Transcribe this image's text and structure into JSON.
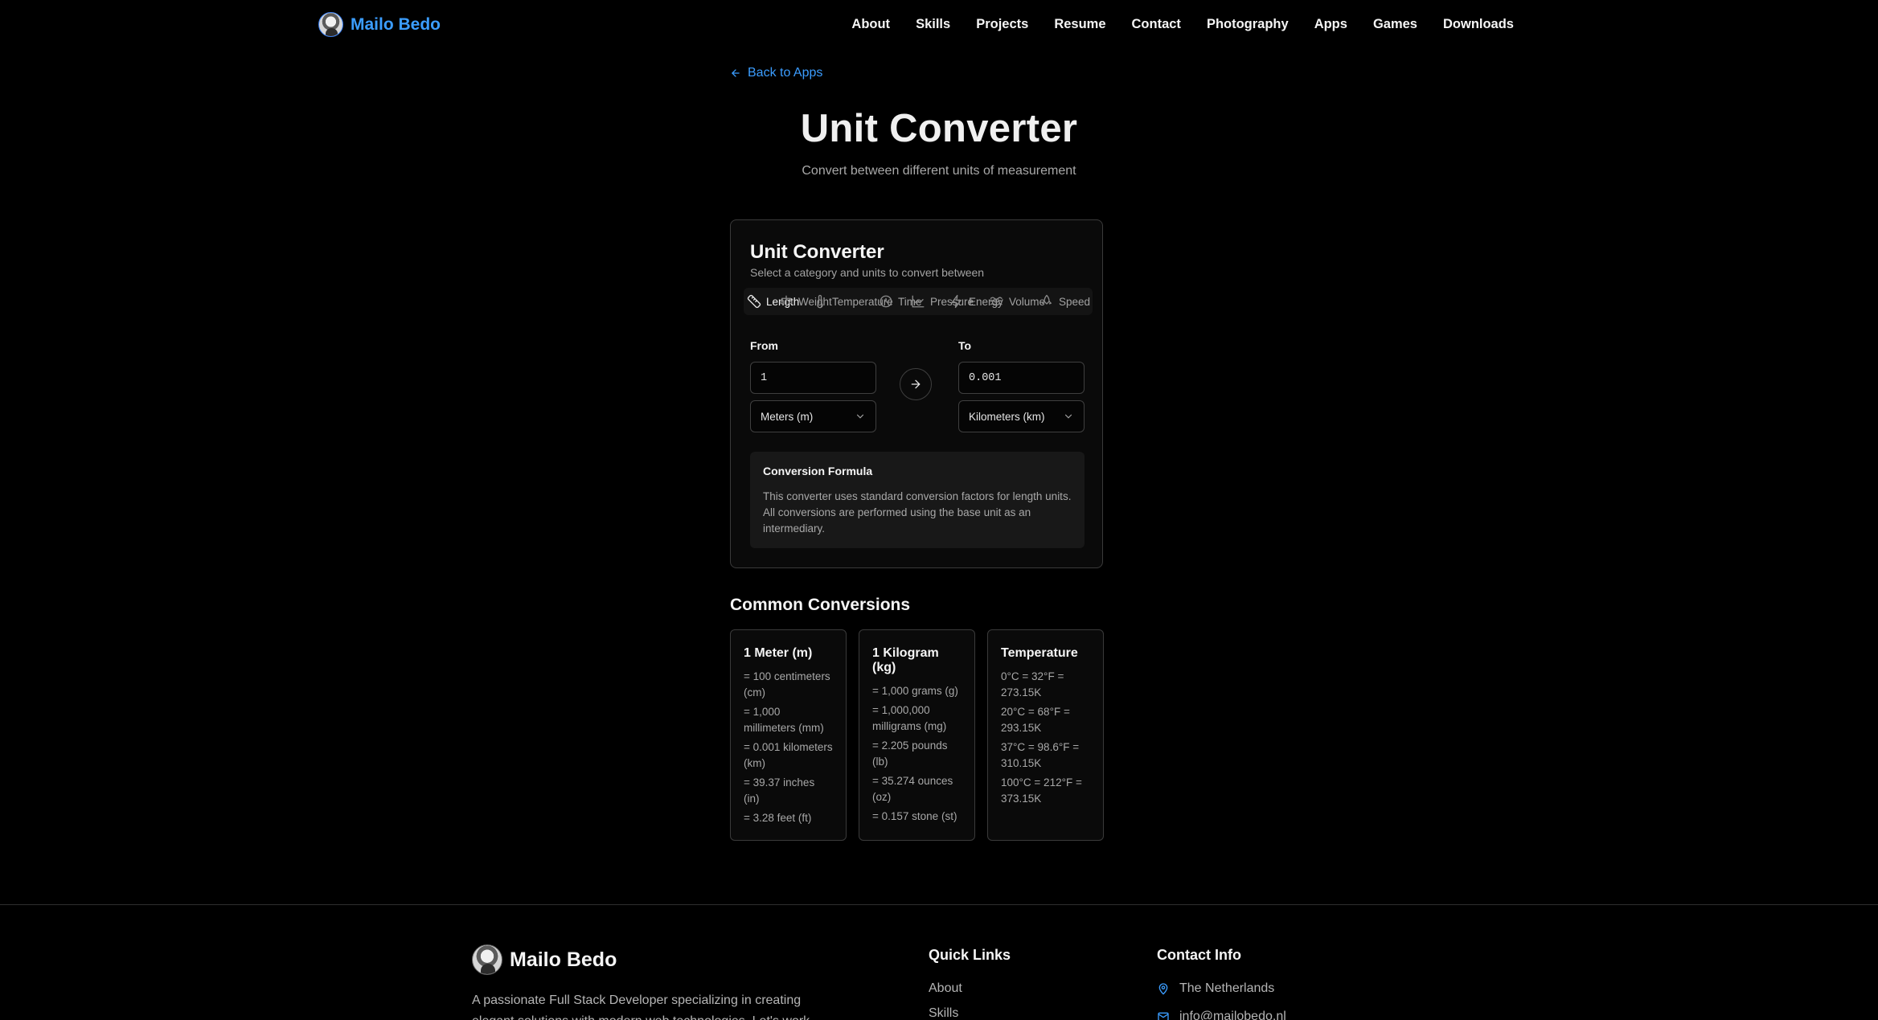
{
  "header": {
    "brand": "Mailo Bedo",
    "nav": [
      "About",
      "Skills",
      "Projects",
      "Resume",
      "Contact",
      "Photography",
      "Apps",
      "Games",
      "Downloads"
    ]
  },
  "back_link": "Back to Apps",
  "page": {
    "title": "Unit Converter",
    "subtitle": "Convert between different units of measurement"
  },
  "converter": {
    "title": "Unit Converter",
    "description": "Select a category and units to convert between",
    "tabs": [
      {
        "label": "Length",
        "icon": "ruler-icon",
        "active": true
      },
      {
        "label": "Weight",
        "icon": "scale-icon",
        "active": false
      },
      {
        "label": "Temperature",
        "icon": "thermometer-icon",
        "active": false
      },
      {
        "label": "Time",
        "icon": "clock-icon",
        "active": false
      },
      {
        "label": "Pressure",
        "icon": "gauge-icon",
        "active": false
      },
      {
        "label": "Energy",
        "icon": "zap-icon",
        "active": false
      },
      {
        "label": "Volume",
        "icon": "waves-icon",
        "active": false
      },
      {
        "label": "Speed",
        "icon": "rocket-icon",
        "active": false
      }
    ],
    "from_label": "From",
    "to_label": "To",
    "from_value": "1",
    "to_value": "0.001",
    "from_unit": "Meters (m)",
    "to_unit": "Kilometers (km)",
    "formula_title": "Conversion Formula",
    "formula_text": "This converter uses standard conversion factors for length units. All conversions are performed using the base unit as an intermediary."
  },
  "common": {
    "title": "Common Conversions",
    "cards": [
      {
        "title": "1 Meter (m)",
        "lines": [
          "= 100 centimeters (cm)",
          "= 1,000 millimeters (mm)",
          "= 0.001 kilometers (km)",
          "= 39.37 inches (in)",
          "= 3.28 feet (ft)"
        ]
      },
      {
        "title": "1 Kilogram (kg)",
        "lines": [
          "= 1,000 grams (g)",
          "= 1,000,000 milligrams (mg)",
          "= 2.205 pounds (lb)",
          "= 35.274 ounces (oz)",
          "= 0.157 stone (st)"
        ]
      },
      {
        "title": "Temperature",
        "lines": [
          "0°C = 32°F = 273.15K",
          "20°C = 68°F = 293.15K",
          "37°C = 98.6°F = 310.15K",
          "100°C = 212°F = 373.15K"
        ]
      }
    ]
  },
  "footer": {
    "brand": "Mailo Bedo",
    "about": "A passionate Full Stack Developer specializing in creating elegant solutions with modern web technologies. Let's work",
    "quick_links_title": "Quick Links",
    "quick_links": [
      "About",
      "Skills"
    ],
    "contact_title": "Contact Info",
    "location": "The Netherlands",
    "email": "info@mailobedo.nl"
  },
  "colors": {
    "accent": "#3b9dff",
    "background": "#000000"
  }
}
